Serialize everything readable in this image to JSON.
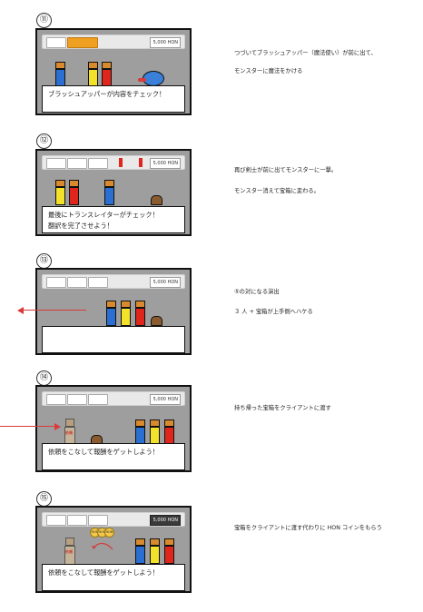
{
  "panels": [
    {
      "num": "⑪",
      "dialog": "ブラッシュアッパーが内容をチェック！",
      "dialog2": "",
      "desc1": "つづいてブラッシュアッパー（魔法使い）が前に出て、",
      "desc2": "モンスターに魔法をかける",
      "coin": "5,000 HON"
    },
    {
      "num": "⑫",
      "dialog": "最後にトランスレイターがチェック！",
      "dialog2": "翻訳を完了させよう！",
      "desc1": "再び剣士が前に出てモンスターに一撃。",
      "desc2": "モンスター消えて宝箱に変わる。",
      "coin": "5,000 HON"
    },
    {
      "num": "⑬",
      "dialog": "",
      "dialog2": "",
      "desc1": "⑤の対になる演出",
      "desc2": "３ 人 + 宝箱が上手側へハケる",
      "coin": "5,000 HON"
    },
    {
      "num": "⑭",
      "dialog": "依頼をこなして報酬をゲットしよう！",
      "dialog2": "",
      "desc1": "持ち帰った宝箱をクライアントに渡す",
      "desc2": "",
      "coin": "5,000 HON"
    },
    {
      "num": "⑮",
      "dialog": "依頼をこなして報酬をゲットしよう！",
      "dialog2": "",
      "desc1": "宝箱をクライアントに渡す代わりに HON コインをもらう",
      "desc2": "",
      "coin": "5,000 HON"
    }
  ],
  "colors": {
    "blue": "#2a6fd1",
    "yellow": "#f3e12a",
    "red": "#e0261c",
    "monster": "#3a7fd8",
    "accent": "#f0a020",
    "arrow": "#d93a3a"
  },
  "client_tag": "依頼",
  "coin_label": "HON"
}
